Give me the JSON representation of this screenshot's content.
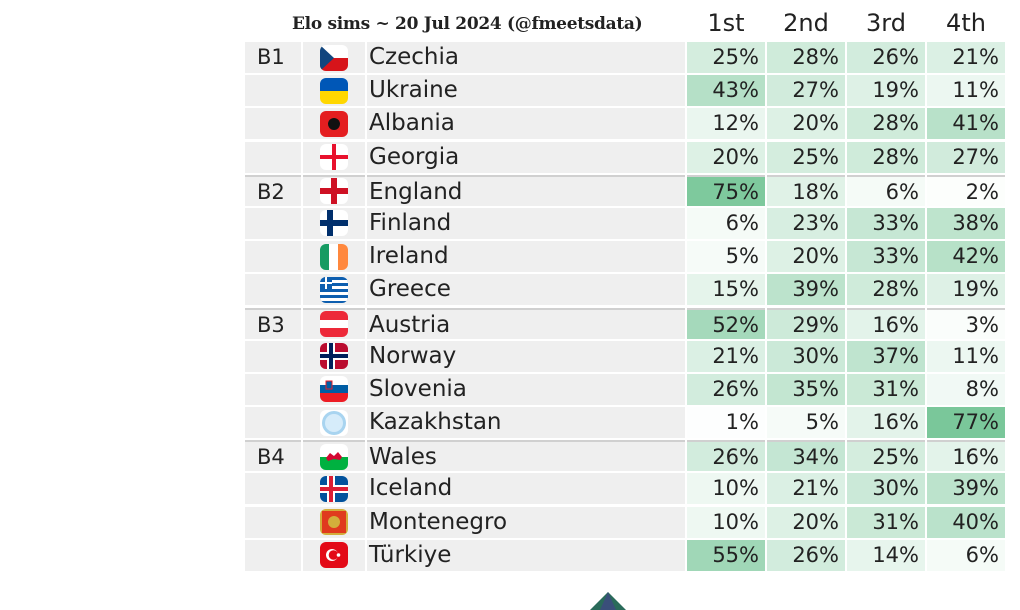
{
  "chart_data": {
    "type": "table",
    "title": "Elo sims ~ 20 Jul 2024 (@fmeetsdata)",
    "columns": [
      "1st",
      "2nd",
      "3rd",
      "4th"
    ],
    "color_scale": {
      "low": "#ffffff",
      "high": "#5dbb84"
    },
    "rows": [
      {
        "group": "B1",
        "team": "Czechia",
        "flag": "czechia-flag-icon",
        "values": [
          25,
          28,
          26,
          21
        ]
      },
      {
        "group": "",
        "team": "Ukraine",
        "flag": "ukraine-flag-icon",
        "values": [
          43,
          27,
          19,
          11
        ]
      },
      {
        "group": "",
        "team": "Albania",
        "flag": "albania-flag-icon",
        "values": [
          12,
          20,
          28,
          41
        ]
      },
      {
        "group": "",
        "team": "Georgia",
        "flag": "georgia-flag-icon",
        "values": [
          20,
          25,
          28,
          27
        ]
      },
      {
        "group": "B2",
        "team": "England",
        "flag": "england-flag-icon",
        "values": [
          75,
          18,
          6,
          2
        ]
      },
      {
        "group": "",
        "team": "Finland",
        "flag": "finland-flag-icon",
        "values": [
          6,
          23,
          33,
          38
        ]
      },
      {
        "group": "",
        "team": "Ireland",
        "flag": "ireland-flag-icon",
        "values": [
          5,
          20,
          33,
          42
        ]
      },
      {
        "group": "",
        "team": "Greece",
        "flag": "greece-flag-icon",
        "values": [
          15,
          39,
          28,
          19
        ]
      },
      {
        "group": "B3",
        "team": "Austria",
        "flag": "austria-flag-icon",
        "values": [
          52,
          29,
          16,
          3
        ]
      },
      {
        "group": "",
        "team": "Norway",
        "flag": "norway-flag-icon",
        "values": [
          21,
          30,
          37,
          11
        ]
      },
      {
        "group": "",
        "team": "Slovenia",
        "flag": "slovenia-flag-icon",
        "values": [
          26,
          35,
          31,
          8
        ]
      },
      {
        "group": "",
        "team": "Kazakhstan",
        "flag": "kazakhstan-flag-icon",
        "values": [
          1,
          5,
          16,
          77
        ]
      },
      {
        "group": "B4",
        "team": "Wales",
        "flag": "wales-flag-icon",
        "values": [
          26,
          34,
          25,
          16
        ]
      },
      {
        "group": "",
        "team": "Iceland",
        "flag": "iceland-flag-icon",
        "values": [
          10,
          21,
          30,
          39
        ]
      },
      {
        "group": "",
        "team": "Montenegro",
        "flag": "montenegro-flag-icon",
        "values": [
          10,
          20,
          31,
          40
        ]
      },
      {
        "group": "",
        "team": "Türkiye",
        "flag": "turkiye-flag-icon",
        "values": [
          55,
          26,
          14,
          6
        ]
      }
    ]
  }
}
